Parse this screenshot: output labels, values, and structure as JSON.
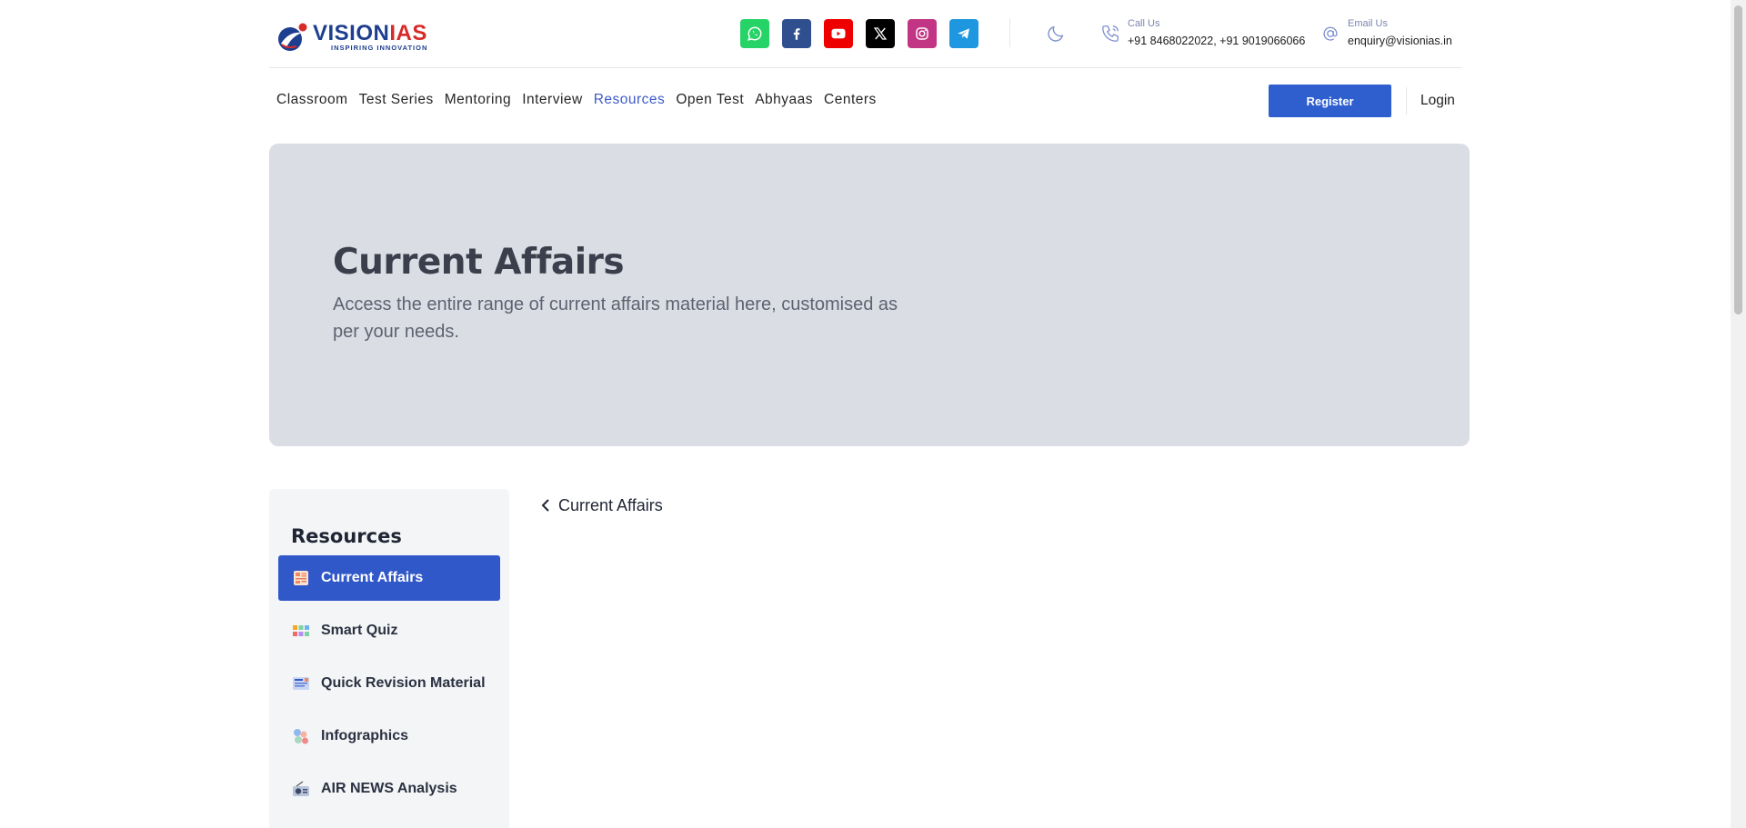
{
  "brand": {
    "name_part1": "VISION",
    "name_part2": "IAS",
    "tagline": "INSPIRING INNOVATION",
    "colors": {
      "primary": "#1e3f8f",
      "accent": "#d72a2a"
    }
  },
  "socials": [
    {
      "icon": "whatsapp-icon",
      "color": "#25d366"
    },
    {
      "icon": "facebook-icon",
      "color": "#2f4f8f"
    },
    {
      "icon": "youtube-icon",
      "color": "#ee0000"
    },
    {
      "icon": "x-icon",
      "color": "#000000"
    },
    {
      "icon": "instagram-icon",
      "color": "#c13584"
    },
    {
      "icon": "telegram-icon",
      "color": "#1e96e0"
    }
  ],
  "contact": {
    "call_label": "Call Us",
    "call_value": "+91 8468022022, +91 9019066066",
    "email_label": "Email Us",
    "email_value": "enquiry@visionias.in"
  },
  "nav": {
    "items": [
      "Classroom",
      "Test Series",
      "Mentoring",
      "Interview",
      "Resources",
      "Open Test",
      "Abhyaas",
      "Centers"
    ],
    "active": "Resources",
    "register_label": "Register",
    "login_label": "Login"
  },
  "hero": {
    "title": "Current Affairs",
    "subtitle": "Access the entire range of current affairs material here, customised as per your needs."
  },
  "sidebar": {
    "title": "Resources",
    "items": [
      {
        "label": "Current Affairs",
        "icon": "news-icon",
        "active": true
      },
      {
        "label": "Smart Quiz",
        "icon": "quiz-icon",
        "active": false
      },
      {
        "label": "Quick Revision Material",
        "icon": "revision-icon",
        "active": false
      },
      {
        "label": "Infographics",
        "icon": "infographics-icon",
        "active": false
      },
      {
        "label": "AIR NEWS Analysis",
        "icon": "radio-icon",
        "active": false
      }
    ]
  },
  "breadcrumb": {
    "label": "Current Affairs",
    "icon": "chevron-left-icon"
  },
  "theme": {
    "active_blue": "#3158c9",
    "hero_bg": "#dbdde5"
  }
}
